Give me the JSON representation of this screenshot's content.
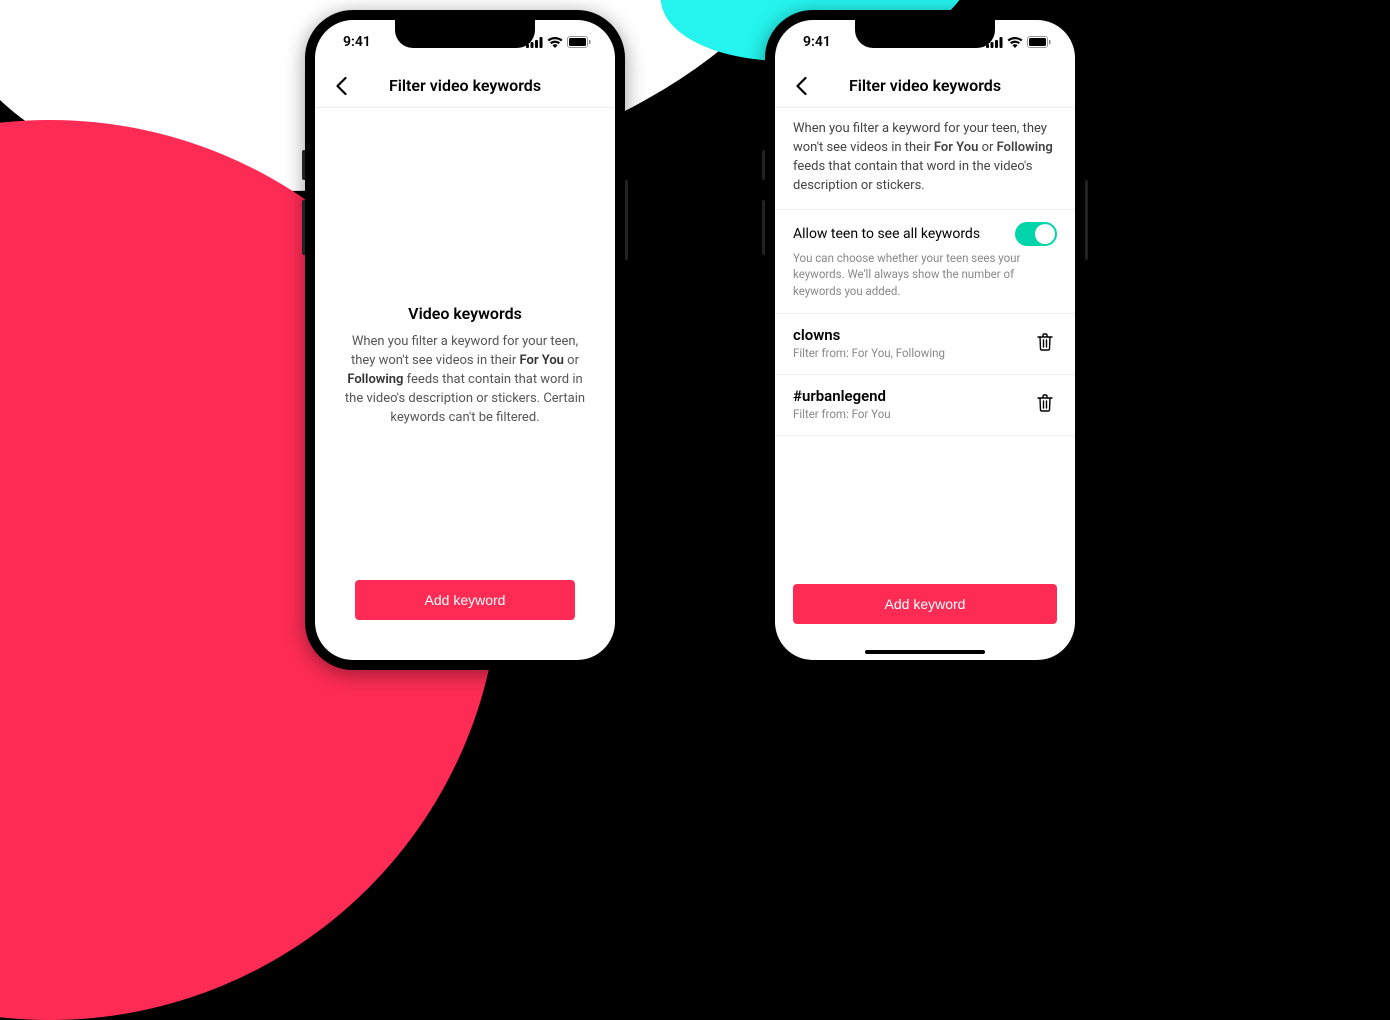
{
  "status": {
    "time": "9:41"
  },
  "phone1": {
    "navTitle": "Filter video keywords",
    "empty": {
      "title": "Video keywords",
      "desc_pre": "When you filter a keyword for your teen, they won't see videos in their ",
      "bold1": "For You",
      "mid1": " or ",
      "bold2": "Following",
      "desc_post": " feeds that contain that word in the video's description or stickers. Certain keywords can't be filtered."
    },
    "addButton": "Add keyword"
  },
  "phone2": {
    "navTitle": "Filter video keywords",
    "intro": {
      "pre": "When you filter a keyword for your teen, they won't see videos in their ",
      "bold1": "For You",
      "mid1": " or ",
      "bold2": "Following",
      "post": " feeds that contain that word in the video's description or stickers."
    },
    "toggle": {
      "label": "Allow teen to see all keywords",
      "desc": "You can choose whether your teen sees your keywords. We'll always show the number of keywords you added."
    },
    "keywords": [
      {
        "name": "clowns",
        "sub": "Filter from: For You, Following"
      },
      {
        "name": "#urbanlegend",
        "sub": "Filter from: For You"
      }
    ],
    "addButton": "Add keyword"
  }
}
